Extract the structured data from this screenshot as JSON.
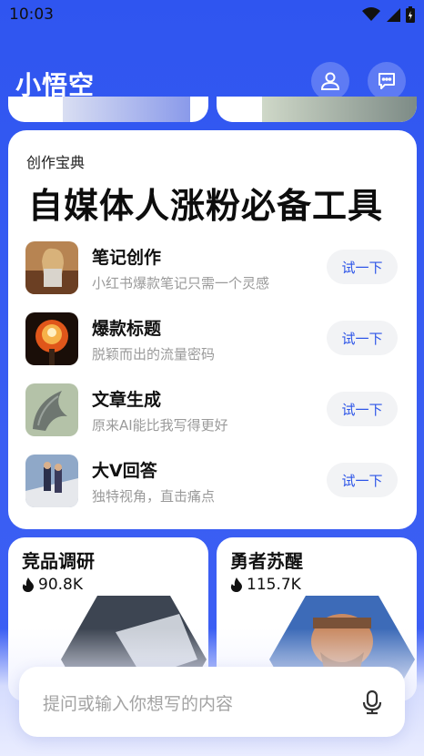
{
  "status_bar": {
    "time": "10:03"
  },
  "header": {
    "app_title": "小悟空"
  },
  "section": {
    "label": "创作宝典",
    "headline": "自媒体人涨粉必备工具",
    "tools": [
      {
        "name": "笔记创作",
        "desc": "小红书爆款笔记只需一个灵感",
        "button": "试一下"
      },
      {
        "name": "爆款标题",
        "desc": "脱颖而出的流量密码",
        "button": "试一下"
      },
      {
        "name": "文章生成",
        "desc": "原来AI能比我写得更好",
        "button": "试一下"
      },
      {
        "name": "大V回答",
        "desc": "独特视角，直击痛点",
        "button": "试一下"
      }
    ]
  },
  "features": [
    {
      "title": "竞品调研",
      "hot": "90.8K"
    },
    {
      "title": "勇者苏醒",
      "hot": "115.7K"
    }
  ],
  "input": {
    "placeholder": "提问或输入你想写的内容"
  },
  "colors": {
    "brand_blue": "#2f55f0",
    "button_text": "#2d55e8"
  }
}
